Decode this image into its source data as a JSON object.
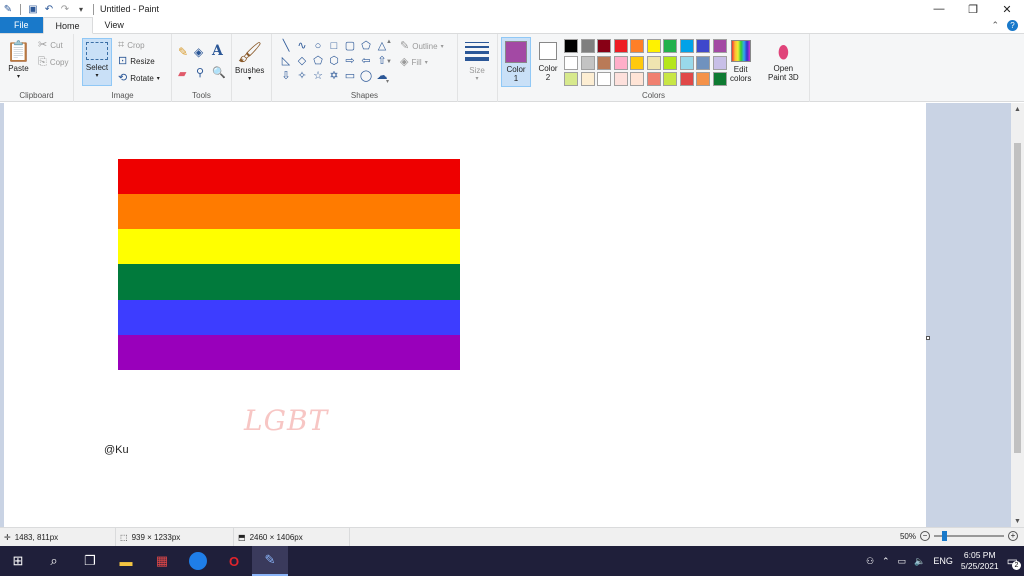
{
  "titlebar": {
    "title": "Untitled - Paint",
    "icons": [
      "paint-app-icon",
      "save-icon",
      "undo-icon",
      "redo-icon",
      "customize-quick-access-icon"
    ],
    "controls": [
      "minimize-icon",
      "restore-icon",
      "close-icon"
    ]
  },
  "tabs": {
    "file": "File",
    "home": "Home",
    "view": "View"
  },
  "ribbon": {
    "clipboard": {
      "label": "Clipboard",
      "paste": "Paste",
      "cut": "Cut",
      "copy": "Copy"
    },
    "image": {
      "label": "Image",
      "select": "Select",
      "crop": "Crop",
      "resize": "Resize",
      "rotate": "Rotate"
    },
    "tools": {
      "label": "Tools"
    },
    "brushes": {
      "label": "Brushes"
    },
    "shapes": {
      "label": "Shapes",
      "outline": "Outline",
      "fill": "Fill"
    },
    "size": {
      "label": "Size"
    },
    "colors": {
      "label": "Colors",
      "color1": "Color",
      "color1_num": "1",
      "color2": "Color",
      "color2_num": "2",
      "color1_value": "#a349a4",
      "color2_value": "#ffffff",
      "edit_colors_1": "Edit",
      "edit_colors_2": "colors",
      "palette": [
        "#000000",
        "#7f7f7f",
        "#880015",
        "#ed1c24",
        "#ff7f27",
        "#fff200",
        "#22b14c",
        "#00a2e8",
        "#3f48cc",
        "#a349a4",
        "#ffffff",
        "#c3c3c3",
        "#b97a57",
        "#ffaec9",
        "#ffc90e",
        "#efe4b0",
        "#b5e61d",
        "#99d9ea",
        "#7092be",
        "#c8bfe7",
        "#d7e98d",
        "#fdeed3",
        "#ffffff",
        "#fde0dc",
        "#ffe4d6",
        "#f08070",
        "#c8e646",
        "#e04848",
        "#f4924a",
        "#0e7a32"
      ]
    },
    "paint3d": {
      "line1": "Open",
      "line2": "Paint 3D"
    }
  },
  "canvas": {
    "flag_stripes": [
      "#ee0000",
      "#ff7b00",
      "#ffff00",
      "#017a3c",
      "#3d3dff",
      "#9900bb"
    ],
    "lgbt_text": "LGBT",
    "signature": "@Ku"
  },
  "status": {
    "cursor": "1483, 811px",
    "selection": "939 × 1233px",
    "image_size": "2460 × 1406px",
    "zoom": "50%",
    "zoom_level": 0.5
  },
  "taskbar": {
    "apps": [
      "windows-start-icon",
      "search-icon",
      "task-view-icon",
      "file-explorer-icon",
      "app-icon",
      "zalo-icon",
      "opera-icon",
      "paint-icon"
    ],
    "lang": "ENG",
    "time": "6:05 PM",
    "date": "5/25/2021",
    "notifications": "2"
  }
}
